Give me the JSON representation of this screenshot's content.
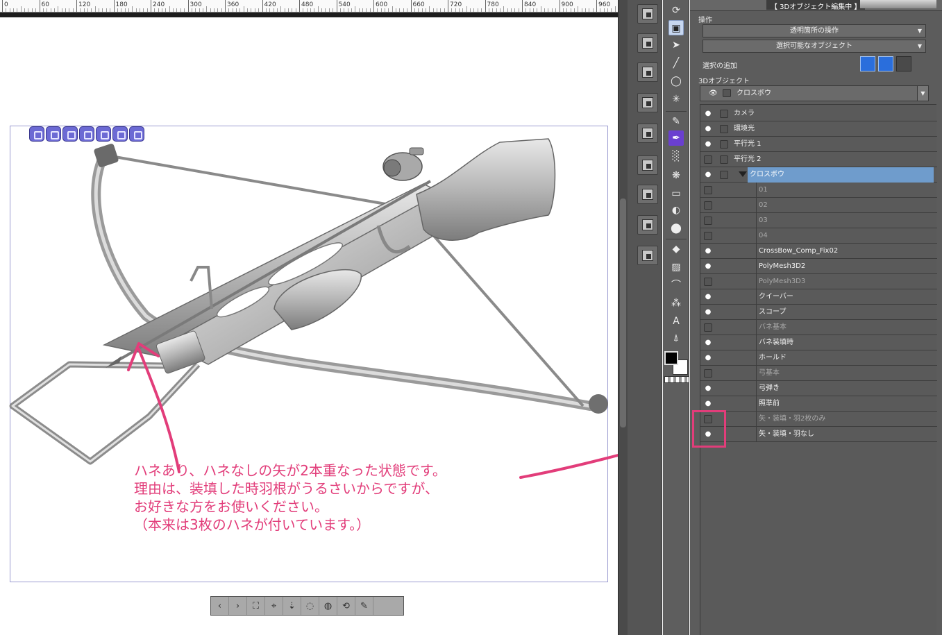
{
  "ruler": {
    "labels": [
      "0",
      "60",
      "120",
      "180",
      "240",
      "300",
      "360",
      "420",
      "480",
      "540",
      "600",
      "660",
      "720",
      "780",
      "840",
      "900",
      "960"
    ]
  },
  "canvas": {
    "note_lines": [
      "ハネあり、ハネなしの矢が2本重なった状態です。",
      "理由は、装填した時羽根がうるさいからですが、",
      "お好きな方をお使いください。",
      "（本来は3枚のハネが付いています。）"
    ],
    "camera_buttons": [
      "‹",
      "›",
      "⛶",
      "⌖",
      "⇣",
      "◌",
      "◍",
      "⟲",
      "✎"
    ],
    "annotation_color": "#e23d7a"
  },
  "panel": {
    "title": "【 3Dオブジェクト編集中 】",
    "operation_label": "操作",
    "transparent_op": "透明箇所の操作",
    "selectable_obj": "選択可能なオブジェクト",
    "add_selection_label": "選択の追加",
    "object_section_label": "3Dオブジェクト",
    "object_selected": "クロスボウ",
    "parts": [
      {
        "label": "カメラ",
        "eye": true,
        "checkbox": true,
        "indent": 0,
        "dim": false
      },
      {
        "label": "環境光",
        "eye": true,
        "checkbox": true,
        "indent": 0,
        "dim": false
      },
      {
        "label": "平行光 1",
        "eye": true,
        "checkbox": true,
        "indent": 0,
        "dim": false
      },
      {
        "label": "平行光 2",
        "eye": false,
        "checkbox": true,
        "indent": 0,
        "dim": false
      },
      {
        "label": "クロスボウ",
        "eye": true,
        "checkbox": true,
        "indent": 0,
        "dim": false,
        "selected": true,
        "expander": true
      },
      {
        "label": "01",
        "eye": false,
        "checkbox": false,
        "indent": 1,
        "dim": true
      },
      {
        "label": "02",
        "eye": false,
        "checkbox": false,
        "indent": 1,
        "dim": true
      },
      {
        "label": "03",
        "eye": false,
        "checkbox": false,
        "indent": 1,
        "dim": true
      },
      {
        "label": "04",
        "eye": false,
        "checkbox": false,
        "indent": 1,
        "dim": true
      },
      {
        "label": "CrossBow_Comp_Fix02",
        "eye": true,
        "checkbox": false,
        "indent": 1,
        "dim": false
      },
      {
        "label": "PolyMesh3D2",
        "eye": true,
        "checkbox": false,
        "indent": 1,
        "dim": false
      },
      {
        "label": "PolyMesh3D3",
        "eye": false,
        "checkbox": false,
        "indent": 1,
        "dim": true
      },
      {
        "label": "クイーバー",
        "eye": true,
        "checkbox": false,
        "indent": 1,
        "dim": false
      },
      {
        "label": "スコープ",
        "eye": true,
        "checkbox": false,
        "indent": 1,
        "dim": false
      },
      {
        "label": "バネ基本",
        "eye": false,
        "checkbox": false,
        "indent": 1,
        "dim": true
      },
      {
        "label": "バネ装填時",
        "eye": true,
        "checkbox": false,
        "indent": 1,
        "dim": false
      },
      {
        "label": "ホールド",
        "eye": true,
        "checkbox": false,
        "indent": 1,
        "dim": false
      },
      {
        "label": "弓基本",
        "eye": false,
        "checkbox": false,
        "indent": 1,
        "dim": true
      },
      {
        "label": "弓弾き",
        "eye": true,
        "checkbox": false,
        "indent": 1,
        "dim": false
      },
      {
        "label": "照準前",
        "eye": true,
        "checkbox": false,
        "indent": 1,
        "dim": false
      },
      {
        "label": "矢・装填・羽2枚のみ",
        "eye": false,
        "checkbox": false,
        "indent": 1,
        "dim": true
      },
      {
        "label": "矢・装填・羽なし",
        "eye": true,
        "checkbox": false,
        "indent": 1,
        "dim": false
      }
    ]
  },
  "tools": {
    "items": [
      "rotate-view-icon",
      "object-select-icon",
      "operation-icon",
      "eyedropper-icon",
      "lasso-icon",
      "magic-wand-icon",
      "pen-icon",
      "brush-icon",
      "airbrush-icon",
      "decoration-icon",
      "eraser-icon",
      "blend-icon",
      "fill-icon",
      "gradient-icon",
      "figure-icon",
      "frame-icon",
      "ruler-icon",
      "text-icon",
      "balloon-icon"
    ]
  }
}
